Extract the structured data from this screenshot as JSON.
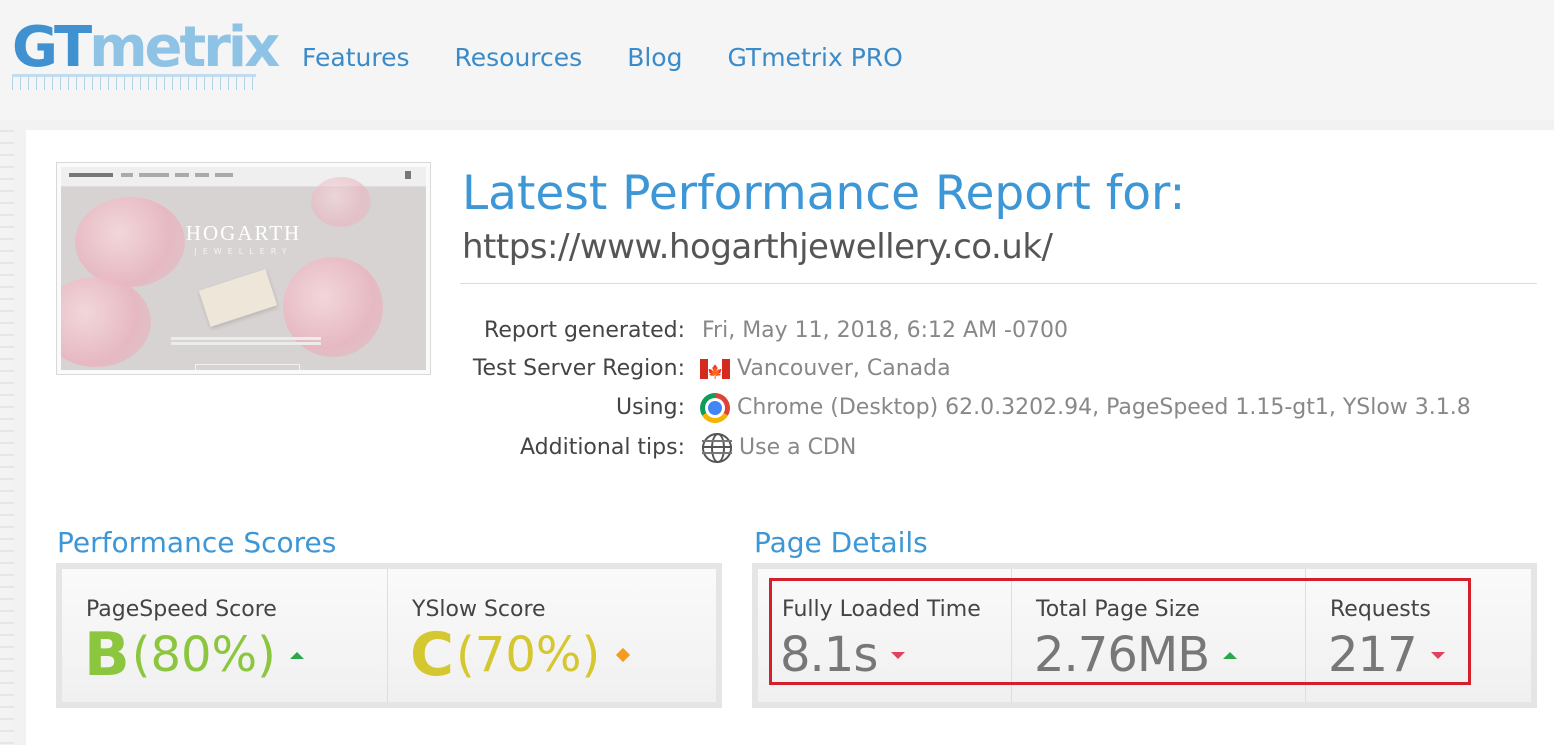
{
  "header": {
    "logo_text_gt": "GT",
    "logo_text_metrix": "metrix",
    "nav": [
      "Features",
      "Resources",
      "Blog",
      "GTmetrix PRO"
    ]
  },
  "thumbnail": {
    "brand": "HOGARTH",
    "sub": "JEWELLERY"
  },
  "report": {
    "title": "Latest Performance Report for:",
    "url": "https://www.hogarthjewellery.co.uk/",
    "rows": [
      {
        "label": "Report generated:",
        "value": "Fri, May 11, 2018, 6:12 AM -0700",
        "icon": ""
      },
      {
        "label": "Test Server Region:",
        "value": "Vancouver, Canada",
        "icon": "canada-flag-icon"
      },
      {
        "label": "Using:",
        "value": "Chrome (Desktop) 62.0.3202.94, PageSpeed 1.15-gt1, YSlow 3.1.8",
        "icon": "chrome-icon"
      },
      {
        "label": "Additional tips:",
        "value": "Use a CDN",
        "icon": "globe-icon"
      }
    ]
  },
  "performance": {
    "title": "Performance Scores",
    "pagespeed": {
      "label": "PageSpeed Score",
      "grade": "B",
      "percent": "(80%)",
      "trend": "up",
      "color": "#8cc63f"
    },
    "yslow": {
      "label": "YSlow Score",
      "grade": "C",
      "percent": "(70%)",
      "trend": "neutral",
      "color": "#d5c730"
    }
  },
  "details": {
    "title": "Page Details",
    "fully_loaded": {
      "label": "Fully Loaded Time",
      "value": "8.1s",
      "trend": "down"
    },
    "page_size": {
      "label": "Total Page Size",
      "value": "2.76MB",
      "trend": "up"
    },
    "requests": {
      "label": "Requests",
      "value": "217",
      "trend": "down"
    }
  },
  "colors": {
    "accent": "#3d97d6",
    "highlight_border": "#d41f2c",
    "trend_up": "#2ba84a",
    "trend_down": "#e0415d"
  }
}
